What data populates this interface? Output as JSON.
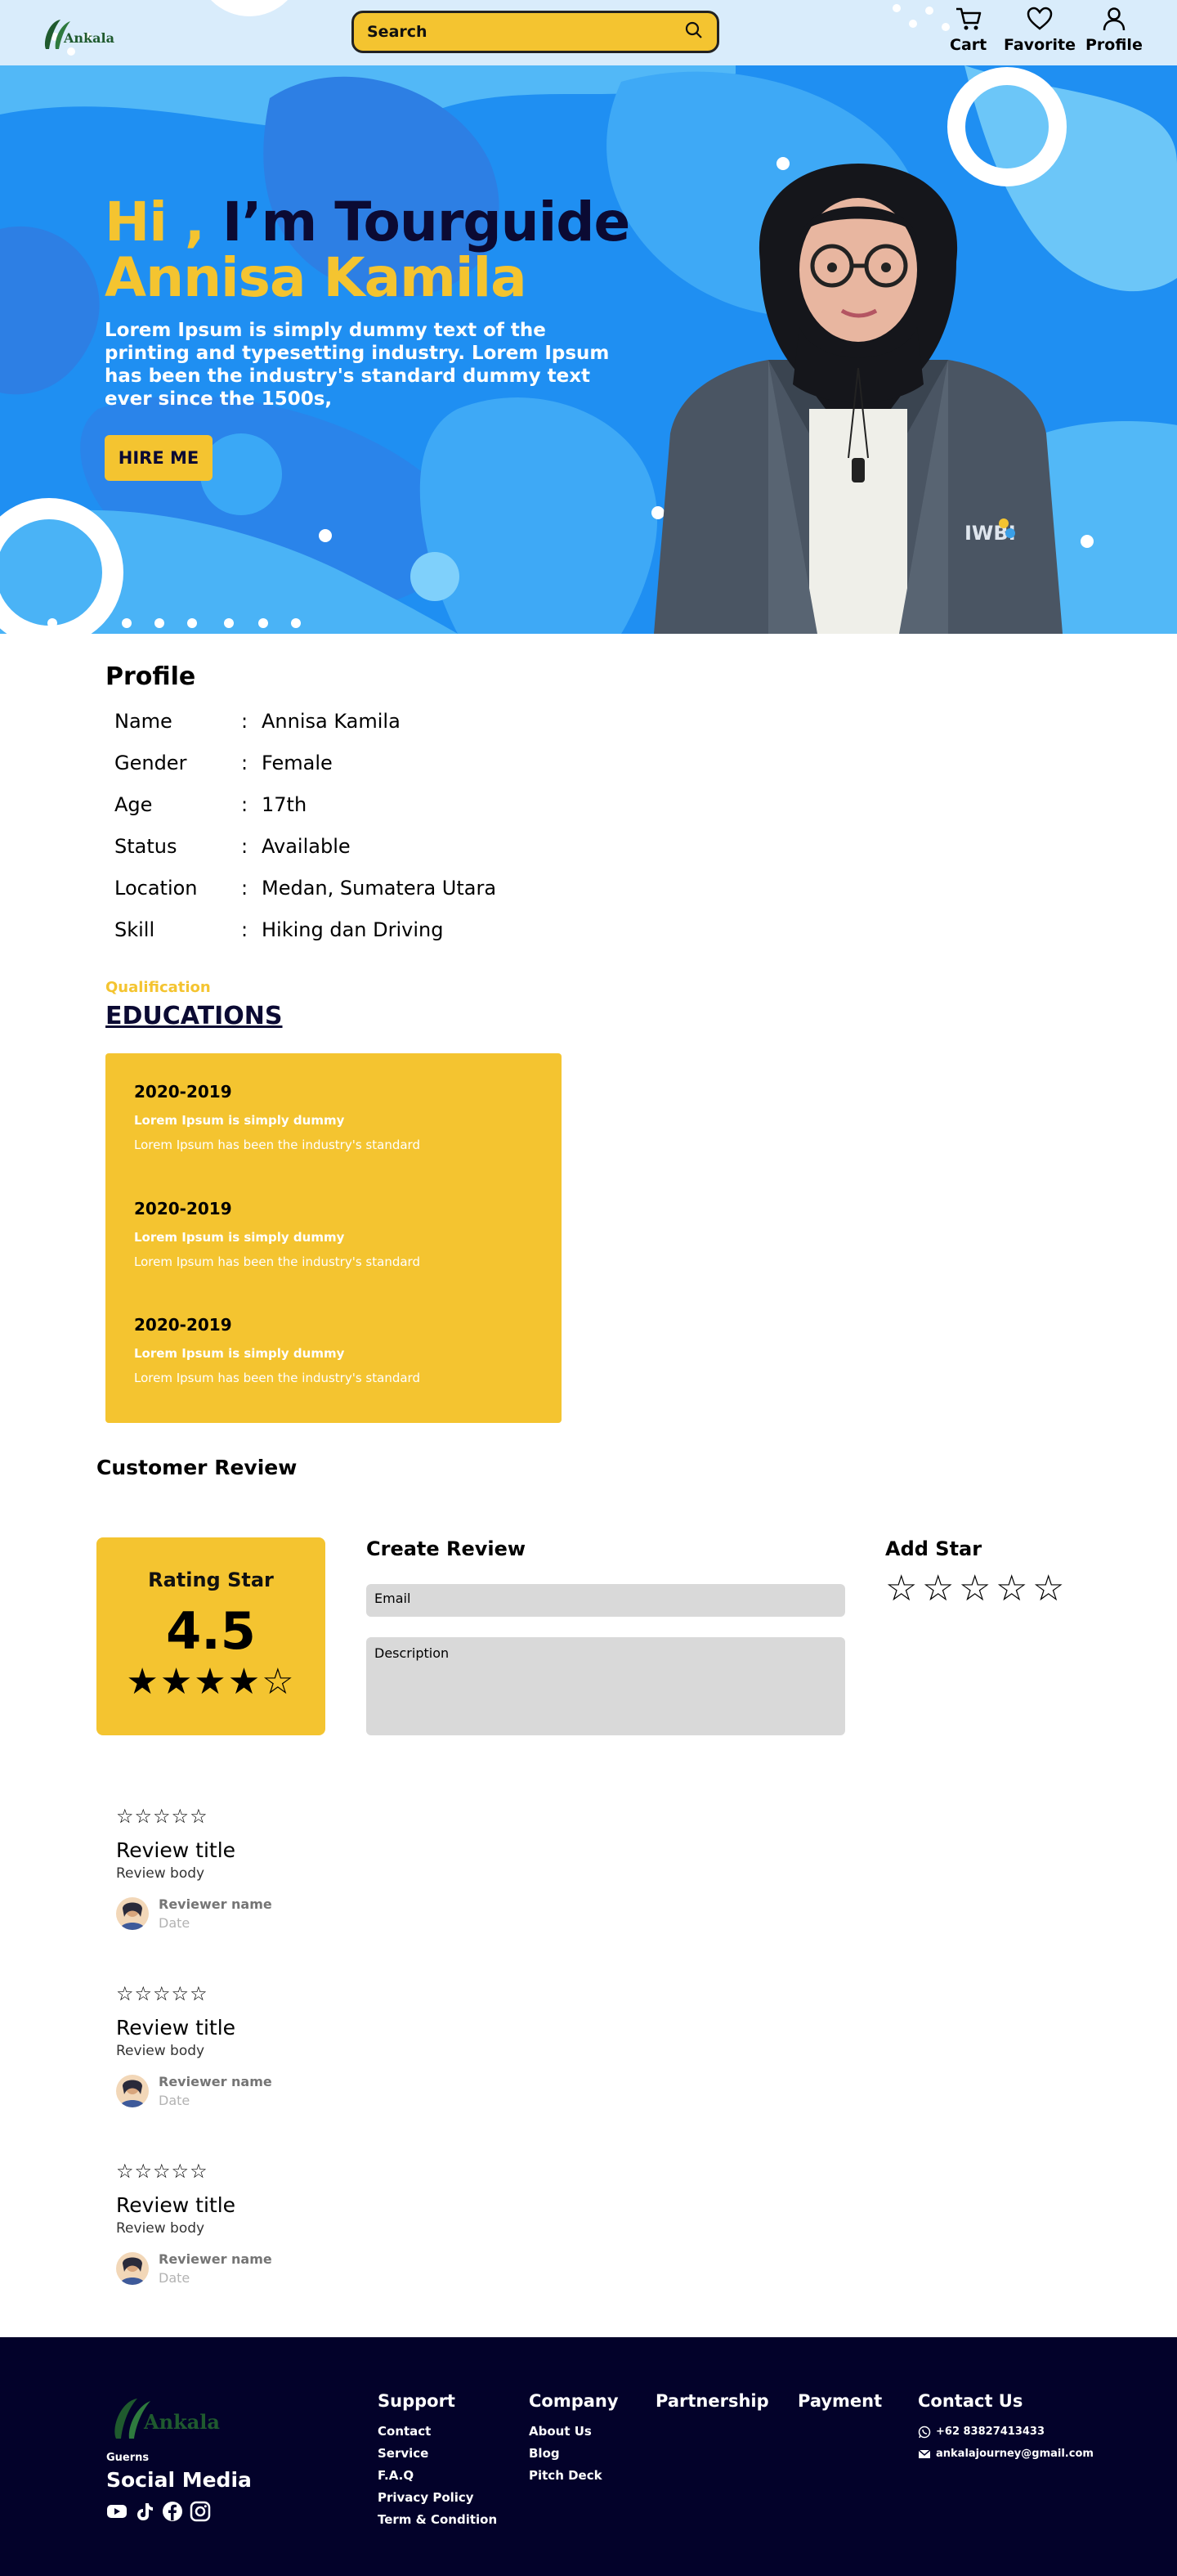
{
  "header": {
    "search_label": "Search",
    "nav": [
      {
        "label": "Cart",
        "icon": "cart-icon"
      },
      {
        "label": "Favorite",
        "icon": "heart-icon"
      },
      {
        "label": "Profile",
        "icon": "user-icon"
      }
    ]
  },
  "hero": {
    "hi": "Hi ,",
    "im": " I’m Tourguide",
    "name": "Annisa Kamila",
    "description": "Lorem Ipsum is simply dummy text of the printing and typesetting industry. Lorem Ipsum has been the industry's standard dummy text ever since the 1500s,",
    "hire_button": "HIRE ME"
  },
  "profile": {
    "title": "Profile",
    "rows": [
      {
        "key": "Name",
        "sep": ":",
        "value": "Annisa Kamila"
      },
      {
        "key": "Gender",
        "sep": ":",
        "value": "Female"
      },
      {
        "key": "Age",
        "sep": ":",
        "value": "17th"
      },
      {
        "key": "Status",
        "sep": ":",
        "value": "Available"
      },
      {
        "key": "Location",
        "sep": ":",
        "value": "Medan, Sumatera Utara"
      },
      {
        "key": "Skill",
        "sep": ":",
        "value": "Hiking dan Driving"
      }
    ]
  },
  "qualification": {
    "label": "Qualification",
    "title": "EDUCATIONS",
    "items": [
      {
        "year": "2020-2019",
        "subtitle": "Lorem Ipsum is simply dummy",
        "body": "Lorem Ipsum has been the industry's standard"
      },
      {
        "year": "2020-2019",
        "subtitle": "Lorem Ipsum is simply dummy",
        "body": "Lorem Ipsum has been the industry's standard"
      },
      {
        "year": "2020-2019",
        "subtitle": "Lorem Ipsum is simply dummy",
        "body": "Lorem Ipsum has been the industry's standard"
      }
    ]
  },
  "review": {
    "title": "Customer Review",
    "rating_label": "Rating Star",
    "rating_value": "4.5",
    "rating_stars": "★★★★☆",
    "create_title": "Create Review",
    "email_label": "Email",
    "description_label": "Description",
    "add_star_title": "Add Star",
    "add_stars": [
      "☆",
      "☆",
      "☆",
      "☆",
      "☆"
    ],
    "items": [
      {
        "stars": "☆☆☆☆☆",
        "title": "Review title",
        "body": "Review body",
        "name": "Reviewer name",
        "date": "Date"
      },
      {
        "stars": "☆☆☆☆☆",
        "title": "Review title",
        "body": "Review body",
        "name": "Reviewer name",
        "date": "Date"
      },
      {
        "stars": "☆☆☆☆☆",
        "title": "Review title",
        "body": "Review body",
        "name": "Reviewer name",
        "date": "Date"
      }
    ]
  },
  "footer": {
    "guerns": "Guerns",
    "social_title": "Social Media",
    "social_icons": [
      "youtube-icon",
      "tiktok-icon",
      "facebook-icon",
      "instagram-icon"
    ],
    "support": {
      "title": "Support",
      "links": [
        "Contact",
        "Service",
        "F.A.Q",
        "Privacy Policy",
        "Term & Condition"
      ]
    },
    "company": {
      "title": "Company",
      "links": [
        "About Us",
        "Blog",
        "Pitch Deck"
      ]
    },
    "partnership": {
      "title": "Partnership"
    },
    "payment": {
      "title": "Payment"
    },
    "contact": {
      "title": "Contact Us",
      "phone": "+62 83827413433",
      "email": "ankalajourney@gmail.com"
    }
  },
  "colors": {
    "accent": "#f4c430",
    "navy": "#0b0a33",
    "hero_blue": "#1a8ff0",
    "footer_bg": "#03022a"
  }
}
